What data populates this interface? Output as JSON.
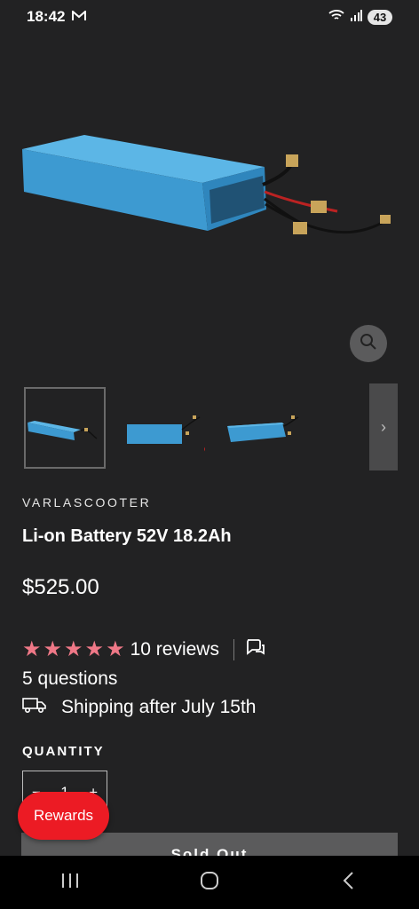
{
  "status_bar": {
    "time": "18:42",
    "battery": "43"
  },
  "product": {
    "vendor": "VARLASCOOTER",
    "title": "Li-on Battery 52V 18.2Ah",
    "price": "$525.00",
    "rating_stars": 5,
    "reviews": "10 reviews",
    "questions": "5 questions",
    "shipping": "Shipping after July 15th"
  },
  "quantity": {
    "label": "QUANTITY",
    "minus": "−",
    "value": "1",
    "plus": "+"
  },
  "add_to_cart": {
    "label": "Sold Out"
  },
  "rewards": {
    "label": "Rewards"
  },
  "thumbnails": {
    "next_arrow": "›"
  },
  "colors": {
    "background": "#222223",
    "rewards": "#ec1b24",
    "stars": "#ef7887",
    "battery_body": "#3d9ad1"
  }
}
